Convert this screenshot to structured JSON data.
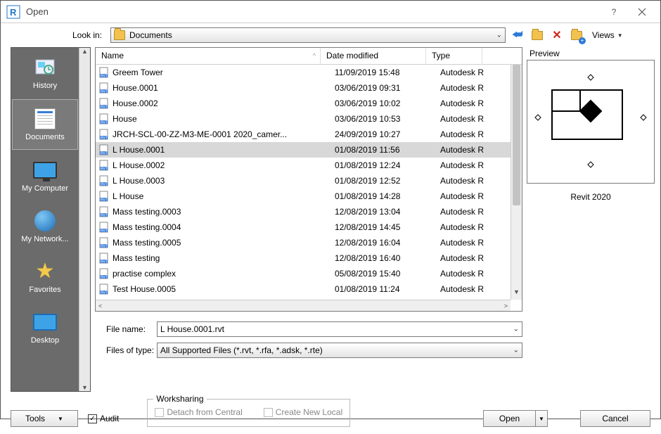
{
  "window": {
    "title": "Open"
  },
  "look_in": {
    "label": "Look in:",
    "value": "Documents"
  },
  "toolbar": {
    "views_label": "Views"
  },
  "places": [
    {
      "id": "history",
      "label": "History"
    },
    {
      "id": "documents",
      "label": "Documents",
      "selected": true
    },
    {
      "id": "mycomputer",
      "label": "My Computer"
    },
    {
      "id": "mynetwork",
      "label": "My Network..."
    },
    {
      "id": "favorites",
      "label": "Favorites"
    },
    {
      "id": "desktop",
      "label": "Desktop"
    }
  ],
  "columns": {
    "name": "Name",
    "date": "Date modified",
    "type": "Type"
  },
  "files": [
    {
      "name": "Greem Tower",
      "date": "11/09/2019 15:48",
      "type": "Autodesk R"
    },
    {
      "name": "House.0001",
      "date": "03/06/2019 09:31",
      "type": "Autodesk R"
    },
    {
      "name": "House.0002",
      "date": "03/06/2019 10:02",
      "type": "Autodesk R"
    },
    {
      "name": "House",
      "date": "03/06/2019 10:53",
      "type": "Autodesk R"
    },
    {
      "name": "JRCH-SCL-00-ZZ-M3-ME-0001 2020_camer...",
      "date": "24/09/2019 10:27",
      "type": "Autodesk R"
    },
    {
      "name": "L House.0001",
      "date": "01/08/2019 11:56",
      "type": "Autodesk R",
      "selected": true
    },
    {
      "name": "L House.0002",
      "date": "01/08/2019 12:24",
      "type": "Autodesk R"
    },
    {
      "name": "L House.0003",
      "date": "01/08/2019 12:52",
      "type": "Autodesk R"
    },
    {
      "name": "L House",
      "date": "01/08/2019 14:28",
      "type": "Autodesk R"
    },
    {
      "name": "Mass testing.0003",
      "date": "12/08/2019 13:04",
      "type": "Autodesk R"
    },
    {
      "name": "Mass testing.0004",
      "date": "12/08/2019 14:45",
      "type": "Autodesk R"
    },
    {
      "name": "Mass testing.0005",
      "date": "12/08/2019 16:04",
      "type": "Autodesk R"
    },
    {
      "name": "Mass testing",
      "date": "12/08/2019 16:40",
      "type": "Autodesk R"
    },
    {
      "name": "practise complex",
      "date": "05/08/2019 15:40",
      "type": "Autodesk R"
    },
    {
      "name": "Test House.0005",
      "date": "01/08/2019 11:24",
      "type": "Autodesk R"
    }
  ],
  "file_name": {
    "label": "File name:",
    "value": "L House.0001.rvt"
  },
  "files_of_type": {
    "label": "Files of type:",
    "value": "All Supported Files  (*.rvt, *.rfa, *.adsk, *.rte)"
  },
  "worksharing": {
    "legend": "Worksharing",
    "detach": "Detach from Central",
    "newlocal": "Create New Local"
  },
  "buttons": {
    "tools": "Tools",
    "audit": "Audit",
    "open": "Open",
    "cancel": "Cancel"
  },
  "audit_checked": true,
  "preview": {
    "label": "Preview",
    "caption": "Revit 2020"
  }
}
